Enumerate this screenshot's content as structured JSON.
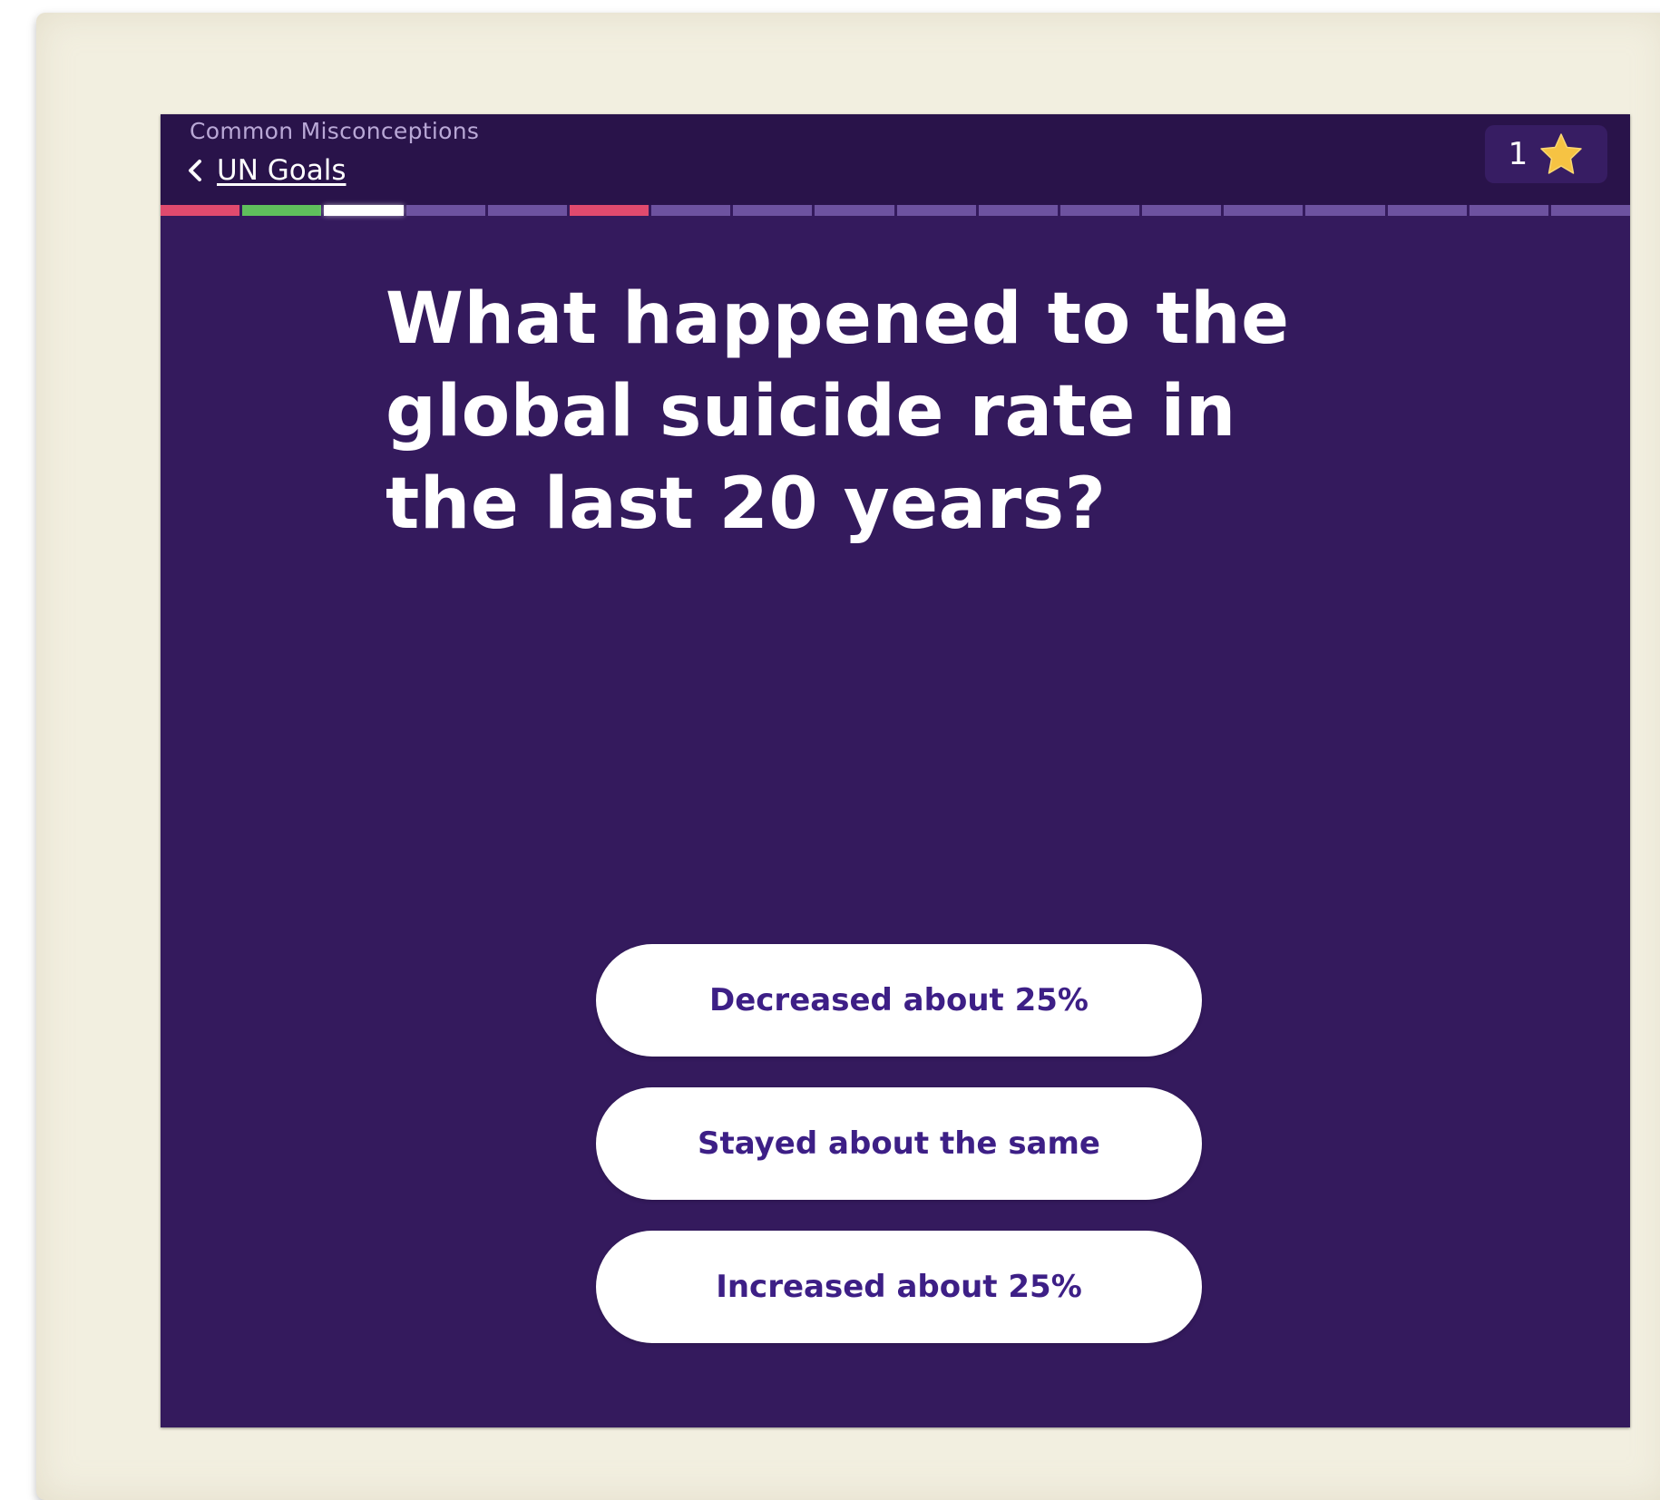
{
  "header": {
    "category": "Common Misconceptions",
    "back_label": "UN Goals",
    "score": "1",
    "score_icon": "star-icon"
  },
  "progress": {
    "segments": [
      "wrong",
      "right",
      "current",
      "todo",
      "todo",
      "wrong",
      "todo",
      "todo",
      "todo",
      "todo",
      "todo",
      "todo",
      "todo",
      "todo",
      "todo",
      "todo",
      "todo",
      "todo"
    ]
  },
  "question": {
    "text": "What happened to the global suicide rate in the last 20 years?"
  },
  "answers": [
    {
      "label": "Decreased about 25%"
    },
    {
      "label": "Stayed about the same"
    },
    {
      "label": "Increased about 25%"
    }
  ],
  "colors": {
    "card_bg": "#341a5d",
    "header_bg": "#29134a",
    "wrong": "#e04a6e",
    "right": "#5fbf5c",
    "pending": "#6d52a0",
    "answer_text": "#3d1f86",
    "star": "#f6c343"
  }
}
